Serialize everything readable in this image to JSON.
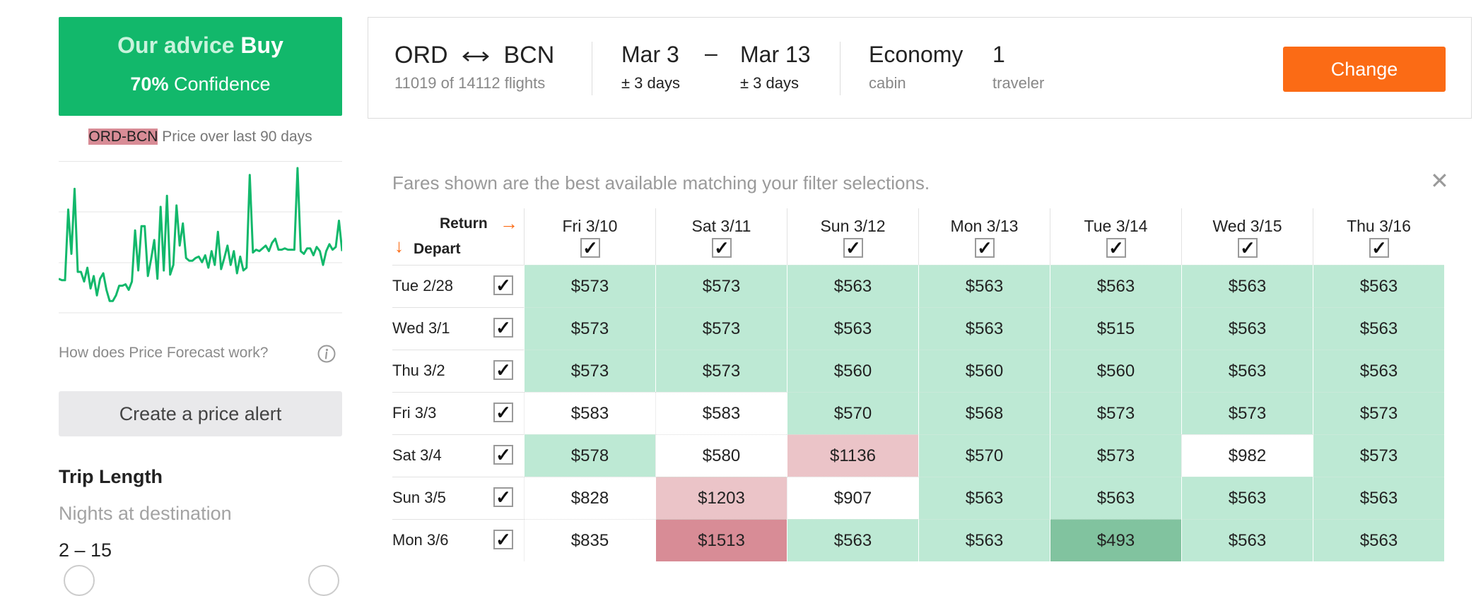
{
  "advice": {
    "prefix": "Our advice",
    "verdict": "Buy",
    "confidence_pct": "70%",
    "confidence_label": "Confidence"
  },
  "price_history": {
    "route": "ORD-BCN",
    "caption": "Price over last 90 days",
    "how_link": "How does Price Forecast work?",
    "series": [
      0.2,
      0.19,
      0.19,
      0.7,
      0.38,
      0.85,
      0.25,
      0.25,
      0.18,
      0.28,
      0.13,
      0.22,
      0.08,
      0.2,
      0.24,
      0.12,
      0.04,
      0.04,
      0.08,
      0.15,
      0.15,
      0.16,
      0.12,
      0.18,
      0.55,
      0.26,
      0.58,
      0.58,
      0.22,
      0.34,
      0.48,
      0.2,
      0.72,
      0.26,
      0.8,
      0.23,
      0.3,
      0.73,
      0.44,
      0.6,
      0.35,
      0.33,
      0.33,
      0.35,
      0.36,
      0.32,
      0.37,
      0.28,
      0.4,
      0.3,
      0.54,
      0.27,
      0.35,
      0.44,
      0.3,
      0.4,
      0.24,
      0.36,
      0.26,
      0.28,
      0.95,
      0.39,
      0.41,
      0.4,
      0.42,
      0.44,
      0.4,
      0.46,
      0.49,
      0.41,
      0.41,
      0.42,
      0.41,
      0.41,
      0.41,
      1.0,
      0.4,
      0.38,
      0.42,
      0.42,
      0.37,
      0.43,
      0.4,
      0.3,
      0.4,
      0.45,
      0.41,
      0.43,
      0.62,
      0.4
    ]
  },
  "alert_button": "Create a price alert",
  "trip_length": {
    "title": "Trip Length",
    "subtitle": "Nights at destination",
    "range": "2 – 15"
  },
  "summary": {
    "origin": "ORD",
    "dest": "BCN",
    "flights": "11019 of 14112 flights",
    "depart_date": "Mar 3",
    "return_date": "Mar 13",
    "dash": "–",
    "depart_flex": "± 3 days",
    "return_flex": "± 3 days",
    "cabin": "Economy",
    "cabin_label": "cabin",
    "travelers": "1",
    "travelers_label": "traveler",
    "change_button": "Change"
  },
  "notice": "Fares shown are the best available matching your filter selections.",
  "close_symbol": "✕",
  "grid": {
    "return_label": "Return",
    "depart_label": "Depart",
    "return_arrow": "→",
    "depart_arrow": "↓",
    "check_mark": "✓",
    "columns": [
      "Fri 3/10",
      "Sat 3/11",
      "Sun 3/12",
      "Mon 3/13",
      "Tue 3/14",
      "Wed 3/15",
      "Thu 3/16"
    ],
    "rows": [
      "Tue 2/28",
      "Wed 3/1",
      "Thu 3/2",
      "Fri 3/3",
      "Sat 3/4",
      "Sun 3/5",
      "Mon 3/6"
    ],
    "prices": [
      [
        "$573",
        "$573",
        "$563",
        "$563",
        "$563",
        "$563",
        "$563"
      ],
      [
        "$573",
        "$573",
        "$563",
        "$563",
        "$515",
        "$563",
        "$563"
      ],
      [
        "$573",
        "$573",
        "$560",
        "$560",
        "$560",
        "$563",
        "$563"
      ],
      [
        "$583",
        "$583",
        "$570",
        "$568",
        "$573",
        "$573",
        "$573"
      ],
      [
        "$578",
        "$580",
        "$1136",
        "$570",
        "$573",
        "$982",
        "$573"
      ],
      [
        "$828",
        "$1203",
        "$907",
        "$563",
        "$563",
        "$563",
        "$563"
      ],
      [
        "$835",
        "$1513",
        "$563",
        "$563",
        "$493",
        "$563",
        "$563"
      ]
    ],
    "tints": [
      [
        "g",
        "g",
        "g",
        "g",
        "g",
        "g",
        "g"
      ],
      [
        "g",
        "g",
        "g",
        "g",
        "g",
        "g",
        "g"
      ],
      [
        "g",
        "g",
        "g",
        "g",
        "g",
        "g",
        "g"
      ],
      [
        "w",
        "w",
        "g",
        "g",
        "g",
        "g",
        "g"
      ],
      [
        "g",
        "w",
        "p",
        "g",
        "g",
        "w",
        "g"
      ],
      [
        "w",
        "p",
        "w",
        "g",
        "g",
        "g",
        "g"
      ],
      [
        "w",
        "r",
        "g",
        "g",
        "dg",
        "g",
        "g"
      ]
    ]
  },
  "colors": {
    "accent_green": "#12b86b",
    "accent_orange": "#fb6b15",
    "cell_green": "#bde9d4",
    "cell_pink": "#ebc4c8",
    "cell_red": "#d88c96",
    "cell_dark_green": "#81c39f"
  }
}
